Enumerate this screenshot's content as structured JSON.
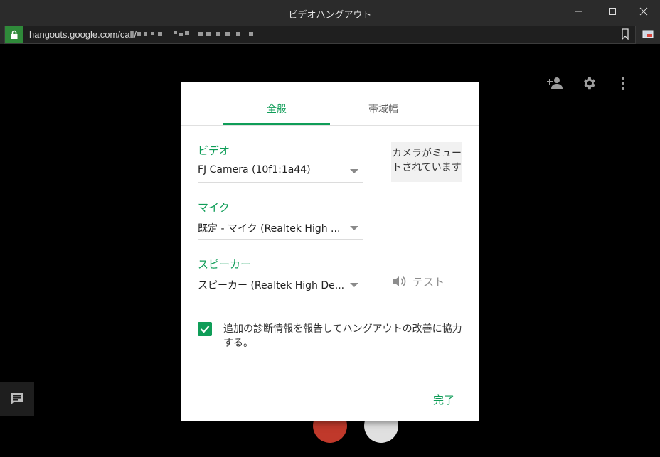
{
  "window": {
    "title": "ビデオハングアウト",
    "controls": {
      "minimize_icon": "minimize-icon",
      "maximize_icon": "maximize-icon",
      "close_icon": "close-icon"
    }
  },
  "addressbar": {
    "url": "hangouts.google.com/call/",
    "secure_icon": "lock-icon",
    "bookmark_icon": "bookmark-icon",
    "extension_icon": "cast-icon"
  },
  "toolbar_icons": [
    "add-person-icon",
    "gear-icon",
    "more-vert-icon"
  ],
  "dialog": {
    "tabs": [
      {
        "label": "全般",
        "active": true
      },
      {
        "label": "帯域幅",
        "active": false
      }
    ],
    "video": {
      "label": "ビデオ",
      "selected": "FJ Camera (10f1:1a44)",
      "camera_status": "カメラがミュートされています"
    },
    "mic": {
      "label": "マイク",
      "selected": "既定 - マイク (Realtek High ..."
    },
    "speaker": {
      "label": "スピーカー",
      "selected": "スピーカー (Realtek High De...",
      "test_label": "テスト"
    },
    "diagnostics": {
      "checked": true,
      "label": "追加の診断情報を報告してハングアウトの改善に協力する。"
    },
    "done_label": "完了"
  },
  "colors": {
    "accent": "#0f9d58",
    "titlebar_bg": "#2b2b2b",
    "page_bg": "#000000",
    "lock_bg": "#2f8a3a",
    "hangup_red": "#c0392b"
  }
}
